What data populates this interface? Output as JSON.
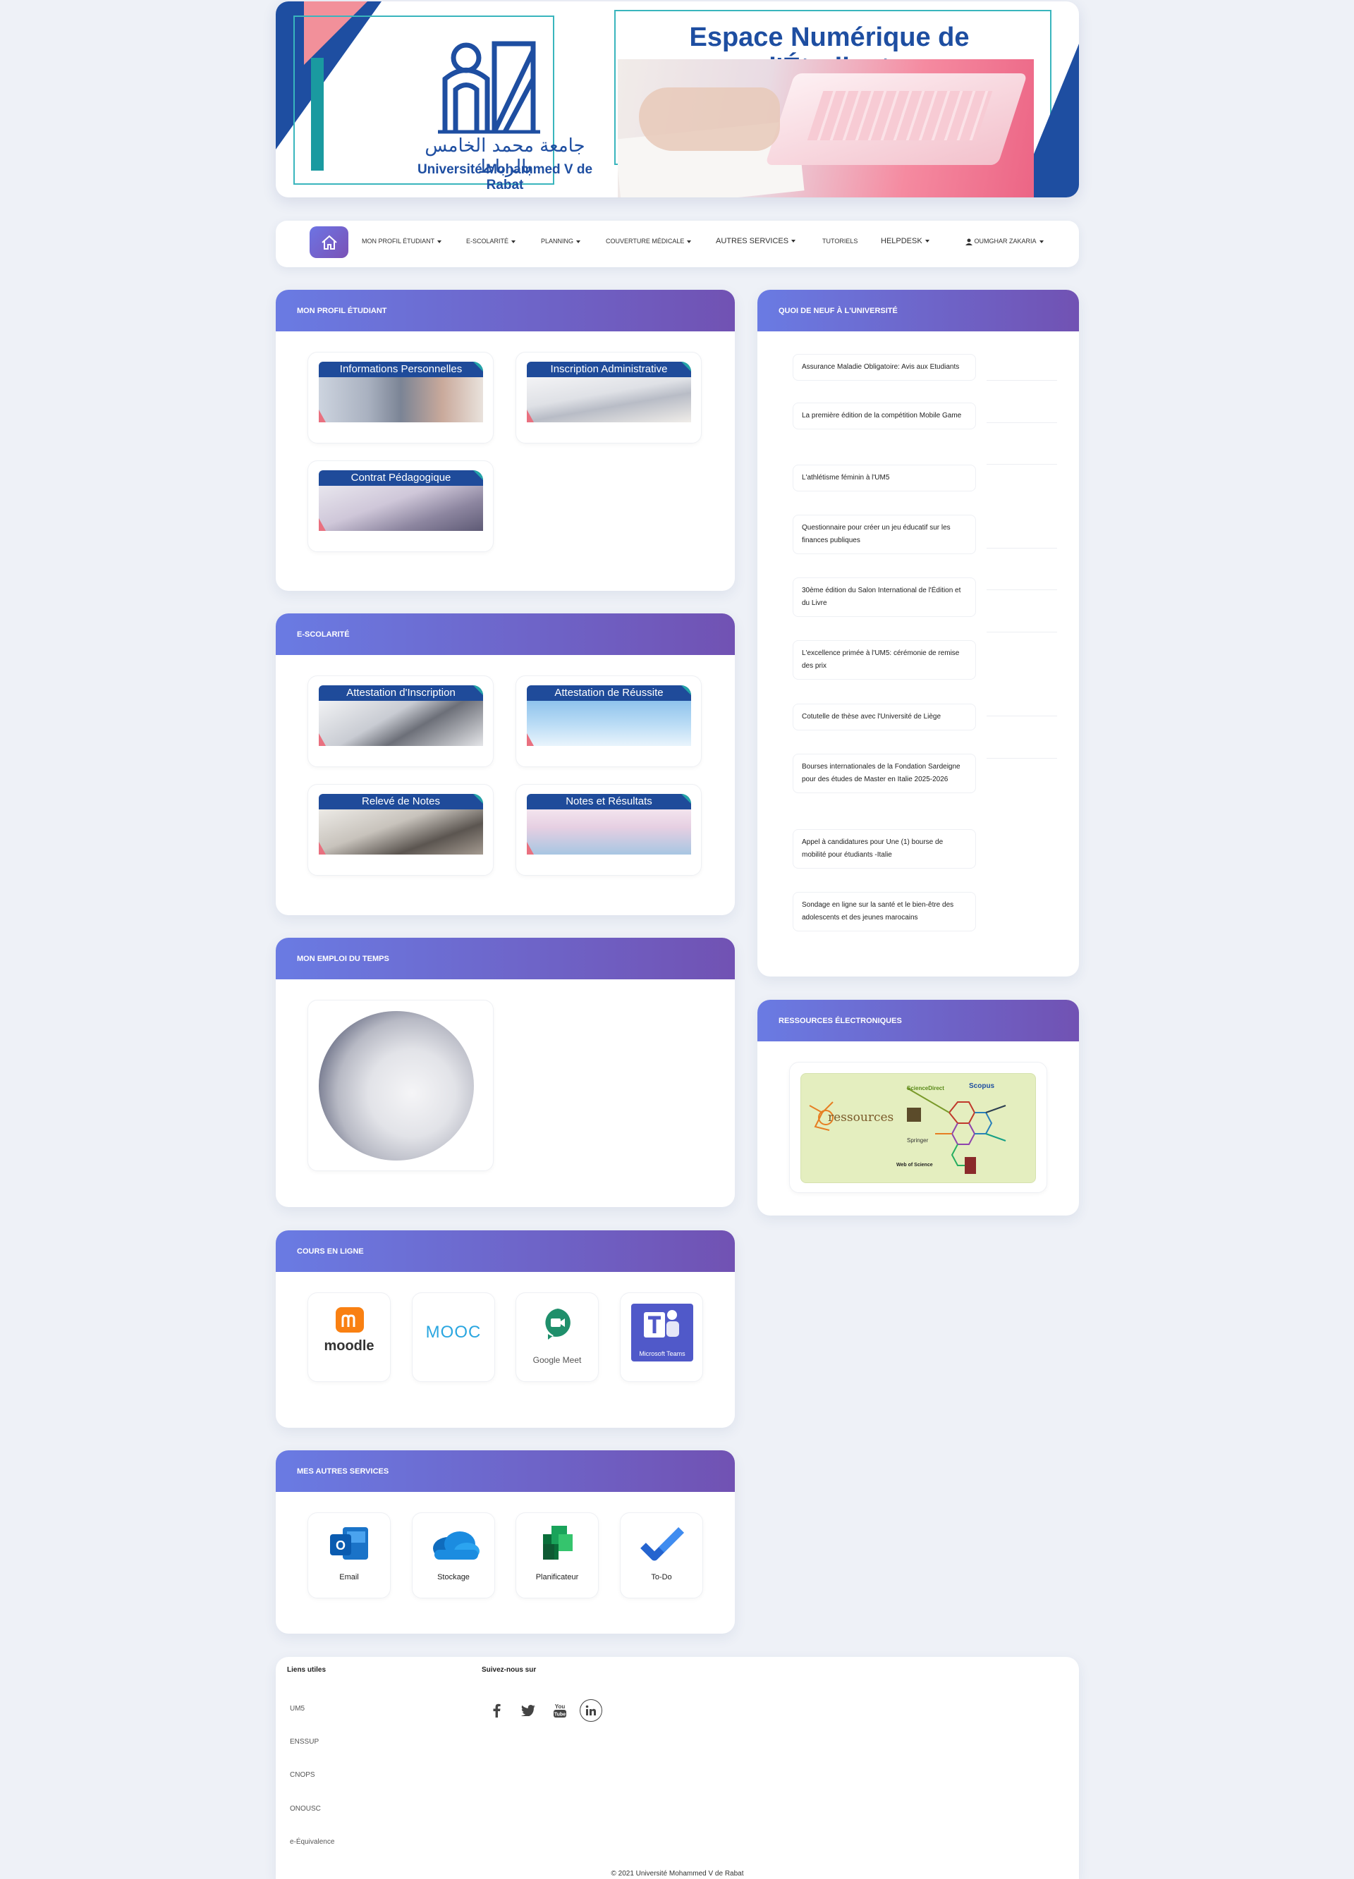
{
  "banner": {
    "title": "Espace Numérique de l'Étudiant",
    "logo_ar": "جامعة محمد الخامس بالرباط",
    "logo_fr": "Université Mohammed V de Rabat"
  },
  "nav": {
    "items": [
      "MON PROFIL ÉTUDIANT",
      "E-SCOLARITÉ",
      "PLANNING",
      "COUVERTURE MÉDICALE",
      "AUTRES SERVICES",
      "TUTORIELS",
      "HELPDESK",
      "OUMGHAR ZAKARIA"
    ]
  },
  "profil": {
    "title": "MON PROFIL ÉTUDIANT",
    "tiles": [
      "Informations Personnelles",
      "Inscription Administrative",
      "Contrat Pédagogique"
    ]
  },
  "escolarite": {
    "title": "E-SCOLARITÉ",
    "tiles": [
      "Attestation d'Inscription",
      "Attestation de Réussite",
      "Relevé de Notes",
      "Notes et Résultats"
    ]
  },
  "emploi": {
    "title": "MON EMPLOI DU TEMPS"
  },
  "cours": {
    "title": "COURS EN LIGNE",
    "items": [
      "moodle",
      "MOOC",
      "Google Meet",
      "Microsoft Teams"
    ]
  },
  "services": {
    "title": "MES AUTRES SERVICES",
    "items": [
      "Email",
      "Stockage",
      "Planificateur",
      "To-Do"
    ]
  },
  "news": {
    "title": "QUOI DE NEUF À L'UNIVERSITÉ",
    "items": [
      "Assurance Maladie Obligatoire: Avis aux Etudiants",
      "La première édition de la compétition Mobile Game",
      "L'athlétisme féminin à l'UM5",
      "Questionnaire pour créer un jeu éducatif sur les finances publiques",
      "30ème édition du Salon International de l'Édition et du Livre",
      "L'excellence primée à l'UM5: cérémonie de remise des prix",
      "Cotutelle de thèse avec l'Université de Liège",
      "Bourses internationales de la Fondation Sardeigne pour des études de Master en Italie 2025-2026",
      "Appel à candidatures pour Une (1) bourse de mobilité pour étudiants -Italie",
      "Sondage en ligne sur la santé et le bien-être des adolescents et des jeunes marocains"
    ]
  },
  "ressources": {
    "title": "RESSOURCES ÉLECTRONIQUES",
    "logo_text": "ressources",
    "labels": [
      "ScienceDirect",
      "Scopus",
      "Springer",
      "Web of Science"
    ]
  },
  "footer": {
    "links_title": "Liens utiles",
    "links": [
      "UM5",
      "ENSSUP",
      "CNOPS",
      "ONOUSC",
      "e-Équivalence"
    ],
    "social_title": "Suivez-nous sur",
    "social": [
      "facebook-icon",
      "twitter-icon",
      "youtube-icon",
      "linkedin-icon"
    ],
    "copyright": "© 2021 Université Mohammed V de Rabat"
  },
  "colors": {
    "header_gradient_start": "#6a7be3",
    "header_gradient_end": "#7152b3",
    "brand_blue": "#1e4ea1",
    "accent_teal": "#1a9aa0",
    "accent_pink": "#f2909a"
  }
}
